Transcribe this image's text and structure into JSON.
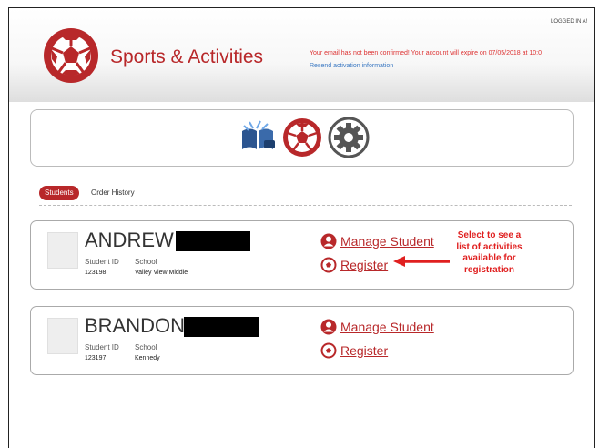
{
  "header": {
    "app_title": "Sports & Activities",
    "logged_in": "LOGGED IN A!",
    "alert": "Your email has not been confirmed! Your account will expire on 07/05/2018 at 10:0",
    "resend_link": "Resend activation information"
  },
  "icon_bar": {
    "icons": [
      "book-icon",
      "soccer-ball-icon",
      "gear-icon"
    ]
  },
  "tabs": {
    "students": "Students",
    "order_history": "Order History"
  },
  "students": [
    {
      "name": "ANDREW",
      "student_id_label": "Student ID",
      "school_label": "School",
      "student_id": "123198",
      "school": "Valley View Middle",
      "manage_label": "Manage Student",
      "register_label": "Register"
    },
    {
      "name": "BRANDON",
      "student_id_label": "Student ID",
      "school_label": "School",
      "student_id": "123197",
      "school": "Kennedy",
      "manage_label": "Manage Student",
      "register_label": "Register"
    }
  ],
  "annotation": {
    "line1": "Select to see a",
    "line2": "list of activities",
    "line3": "available for",
    "line4": "registration"
  },
  "colors": {
    "brand": "#b8282a",
    "alert": "#dd3333",
    "link": "#3a78c2",
    "annotation": "#e02020"
  }
}
